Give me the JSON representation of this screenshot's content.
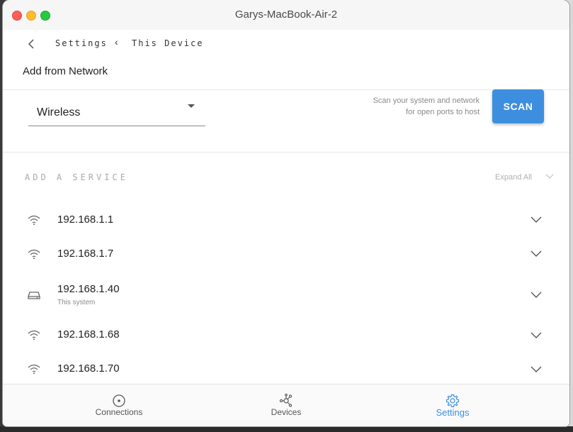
{
  "window": {
    "title": "Garys-MacBook-Air-2"
  },
  "header": {
    "breadcrumb": [
      "Settings",
      "This Device"
    ],
    "breadcrumb_separator": "‹",
    "page_title": "Add from Network"
  },
  "scan": {
    "select_value": "Wireless",
    "hint_line1": "Scan your system and network",
    "hint_line2": "for open ports to host",
    "button_label": "SCAN"
  },
  "services": {
    "title": "ADD A SERVICE",
    "expand_all": "Expand All",
    "items": [
      {
        "icon": "wifi-icon",
        "ip": "192.168.1.1",
        "subtitle": ""
      },
      {
        "icon": "wifi-icon",
        "ip": "192.168.1.7",
        "subtitle": ""
      },
      {
        "icon": "hard-drive-icon",
        "ip": "192.168.1.40",
        "subtitle": "This system"
      },
      {
        "icon": "wifi-icon",
        "ip": "192.168.1.68",
        "subtitle": ""
      },
      {
        "icon": "wifi-icon",
        "ip": "192.168.1.70",
        "subtitle": ""
      }
    ]
  },
  "nav": {
    "items": [
      {
        "label": "Connections",
        "icon": "connections-icon",
        "active": false
      },
      {
        "label": "Devices",
        "icon": "devices-icon",
        "active": false
      },
      {
        "label": "Settings",
        "icon": "gear-icon",
        "active": true
      }
    ]
  },
  "colors": {
    "accent": "#3e8ee0",
    "muted": "#8a8a8a"
  }
}
